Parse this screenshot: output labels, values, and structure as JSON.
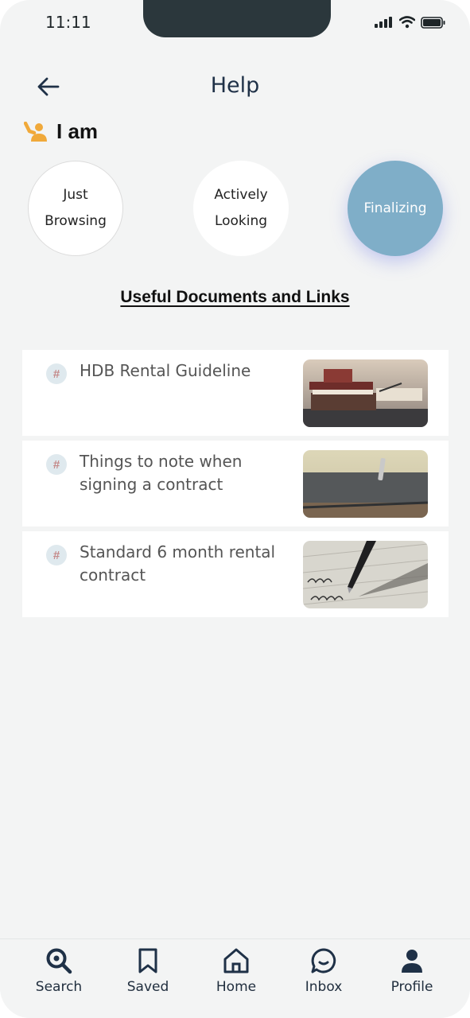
{
  "status_bar": {
    "time": "11:11"
  },
  "header": {
    "title": "Help"
  },
  "stage": {
    "label": "I am",
    "options": [
      {
        "label_line1": "Just",
        "label_line2": "Browsing",
        "selected": false
      },
      {
        "label_line1": "Actively",
        "label_line2": "Looking",
        "selected": false
      },
      {
        "label_line1": "Finalizing",
        "label_line2": "",
        "selected": true
      }
    ]
  },
  "section_title": "Useful Documents and Links",
  "documents": [
    {
      "title": "HDB Rental Guideline",
      "icon": "hash-icon"
    },
    {
      "title": "Things to note when signing a contract",
      "icon": "hash-icon"
    },
    {
      "title": "Standard 6 month rental contract",
      "icon": "hash-icon"
    }
  ],
  "tabs": [
    {
      "label": "Search",
      "icon": "search-icon"
    },
    {
      "label": "Saved",
      "icon": "bookmark-icon"
    },
    {
      "label": "Home",
      "icon": "home-icon"
    },
    {
      "label": "Inbox",
      "icon": "chat-icon"
    },
    {
      "label": "Profile",
      "icon": "user-icon"
    }
  ],
  "colors": {
    "accent": "#7faec8",
    "icon_yellow": "#f0a93a",
    "navy": "#1f3147"
  }
}
